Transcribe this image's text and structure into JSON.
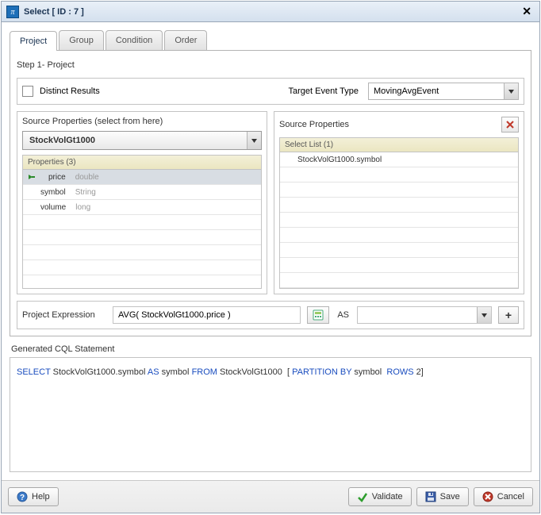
{
  "titlebar": {
    "icon_char": "π",
    "title": "Select [ ID : 7 ]"
  },
  "tabs": [
    {
      "label": "Project",
      "active": true
    },
    {
      "label": "Group",
      "active": false
    },
    {
      "label": "Condition",
      "active": false
    },
    {
      "label": "Order",
      "active": false
    }
  ],
  "step_label": "Step 1- Project",
  "distinct": {
    "label": "Distinct Results",
    "checked": false
  },
  "target_event_type": {
    "label": "Target Event Type",
    "value": "MovingAvgEvent"
  },
  "left_panel": {
    "title": "Source Properties (select from here)",
    "source_select": "StockVolGt1000",
    "grid_head": "Properties (3)",
    "rows": [
      {
        "name": "price",
        "type": "double",
        "selected": true
      },
      {
        "name": "symbol",
        "type": "String",
        "selected": false
      },
      {
        "name": "volume",
        "type": "long",
        "selected": false
      }
    ]
  },
  "right_panel": {
    "title": "Source Properties",
    "grid_head": "Select List (1)",
    "rows": [
      {
        "text": "StockVolGt1000.symbol"
      }
    ]
  },
  "expression": {
    "label": "Project Expression",
    "value": "AVG( StockVolGt1000.price )",
    "as_label": "AS",
    "as_value": ""
  },
  "generated": {
    "label": "Generated CQL Statement",
    "tokens": {
      "select": "SELECT",
      "col": "StockVolGt1000.symbol",
      "as": "AS",
      "alias": "symbol",
      "from": "FROM",
      "src": "StockVolGt1000",
      "lbracket": "[",
      "partition_by": "PARTITION BY",
      "part_col": "symbol",
      "rows_kw": "ROWS",
      "rows_n": "2",
      "rbracket": "]"
    }
  },
  "footer": {
    "help": "Help",
    "validate": "Validate",
    "save": "Save",
    "cancel": "Cancel"
  }
}
